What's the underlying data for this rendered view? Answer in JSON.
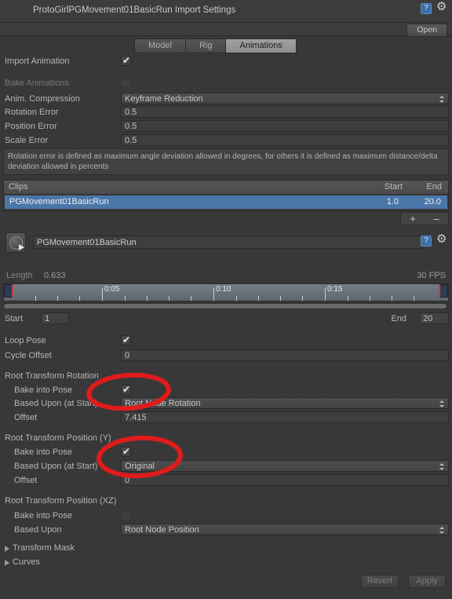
{
  "window": {
    "title": "ProtoGirlPGMovement01BasicRun Import Settings",
    "help_icon": "help-book-icon",
    "gear_icon": "gear-icon",
    "open_label": "Open"
  },
  "tabs": [
    {
      "label": "Model",
      "selected": false
    },
    {
      "label": "Rig",
      "selected": false
    },
    {
      "label": "Animations",
      "selected": true
    }
  ],
  "import": {
    "import_animation_label": "Import Animation",
    "import_animation_checked": true,
    "bake_animations_label": "Bake Animations",
    "bake_animations_checked": false,
    "anim_compression_label": "Anim. Compression",
    "anim_compression_value": "Keyframe Reduction",
    "rotation_error_label": "Rotation Error",
    "rotation_error_value": "0.5",
    "position_error_label": "Position Error",
    "position_error_value": "0.5",
    "scale_error_label": "Scale Error",
    "scale_error_value": "0.5",
    "help_text": "Rotation error is defined as maximum angle deviation allowed in degrees, for others it is defined as maximum distance/delta deviation allowed in percents"
  },
  "clips": {
    "header_name": "Clips",
    "header_start": "Start",
    "header_end": "End",
    "rows": [
      {
        "name": "PGMovement01BasicRun",
        "start": "1.0",
        "end": "20.0",
        "selected": true
      }
    ],
    "add_label": "+",
    "remove_label": "–"
  },
  "clip_editor": {
    "play_icon": "play-icon",
    "clip_name": "PGMovement01BasicRun",
    "help_icon": "help-book-icon",
    "gear_icon": "gear-icon",
    "length_label": "Length",
    "length_value": "0.633",
    "fps_label": "30 FPS",
    "timeline_ticks": [
      "0:05",
      "0:10",
      "0:15"
    ],
    "start_label": "Start",
    "start_value": "1",
    "end_label": "End",
    "end_value": "20"
  },
  "loop": {
    "loop_pose_label": "Loop Pose",
    "loop_pose_checked": true,
    "cycle_offset_label": "Cycle Offset",
    "cycle_offset_value": "0"
  },
  "root_rotation": {
    "section_label": "Root Transform Rotation",
    "bake_label": "Bake into Pose",
    "bake_checked": true,
    "based_upon_label": "Based Upon (at Start)",
    "based_upon_value": "Root Node Rotation",
    "offset_label": "Offset",
    "offset_value": "7.415"
  },
  "root_position_y": {
    "section_label": "Root Transform Position (Y)",
    "bake_label": "Bake into Pose",
    "bake_checked": true,
    "based_upon_label": "Based Upon (at Start)",
    "based_upon_value": "Original",
    "offset_label": "Offset",
    "offset_value": "0"
  },
  "root_position_xz": {
    "section_label": "Root Transform Position (XZ)",
    "bake_label": "Bake into Pose",
    "bake_checked": false,
    "based_upon_label": "Based Upon",
    "based_upon_value": "Root Node Position"
  },
  "foldouts": [
    {
      "label": "Transform Mask"
    },
    {
      "label": "Curves"
    }
  ],
  "footer": {
    "revert_label": "Revert",
    "apply_label": "Apply"
  },
  "annotations": {
    "color": "#e01b1b",
    "ellipses": [
      {
        "name": "highlight-bake-into-pose-rotation"
      },
      {
        "name": "highlight-bake-into-pose-position-y"
      }
    ]
  },
  "colors": {
    "background": "#383838",
    "panel": "#3c3c3c",
    "selection_blue": "#4a76a8",
    "timeline": "#6a727b",
    "annotation_red": "#e01b1b"
  }
}
